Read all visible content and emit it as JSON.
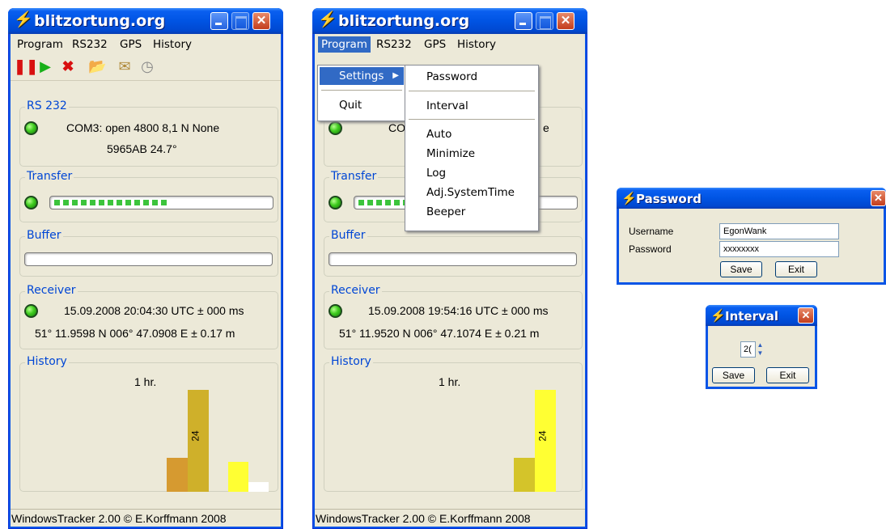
{
  "window_title": "blitzortung.org",
  "menu": [
    "Program",
    "RS232",
    "GPS",
    "History"
  ],
  "toolbar_icons": [
    "pause-icon",
    "play-icon",
    "stop-icon",
    "open-folder-icon",
    "mail-icon",
    "clock-icon"
  ],
  "groups": {
    "rs232": "RS 232",
    "transfer": "Transfer",
    "buffer": "Buffer",
    "receiver": "Receiver",
    "history": "History"
  },
  "left": {
    "com_status": "COM3: open  4800 8,1 N None",
    "device": "5965AB 24.7°",
    "transfer_level": 0.55,
    "buffer_level": 0,
    "datetime": "15.09.2008 20:04:30 UTC ± 000 ms",
    "position": "51° 11.9598 N  006° 47.0908 E ± 0.17 m",
    "history_label": "1 hr.",
    "history_peak": "24"
  },
  "right": {
    "datetime": "15.09.2008 19:54:16 UTC ± 000 ms",
    "position": "51° 11.9520 N  006° 47.1074 E ± 0.21 m",
    "history_label": "1 hr.",
    "history_peak": "24",
    "com_status_fragment_left": "COM",
    "com_status_fragment_right": "e"
  },
  "status_bar": "WindowsTracker 2.00 © E.Korffmann 2008",
  "program_menu": {
    "settings": "Settings",
    "quit": "Quit",
    "submenu": [
      "Password",
      "Interval",
      "Auto",
      "Minimize",
      "Log",
      "Adj.SystemTime",
      "Beeper"
    ]
  },
  "password_dialog": {
    "title": "Password",
    "username_label": "Username",
    "password_label": "Password",
    "username_value": "EgonWank",
    "password_value": "xxxxxxxx",
    "save": "Save",
    "exit": "Exit"
  },
  "interval_dialog": {
    "title": "Interval",
    "value": "2(",
    "save": "Save",
    "exit": "Exit"
  },
  "colors": {
    "accent": "#0054e3",
    "menu_highlight": "#316ac5",
    "led": "#3fcc1f",
    "bar_dark": "#cfa02a",
    "bar_yellow": "#ffff33"
  }
}
